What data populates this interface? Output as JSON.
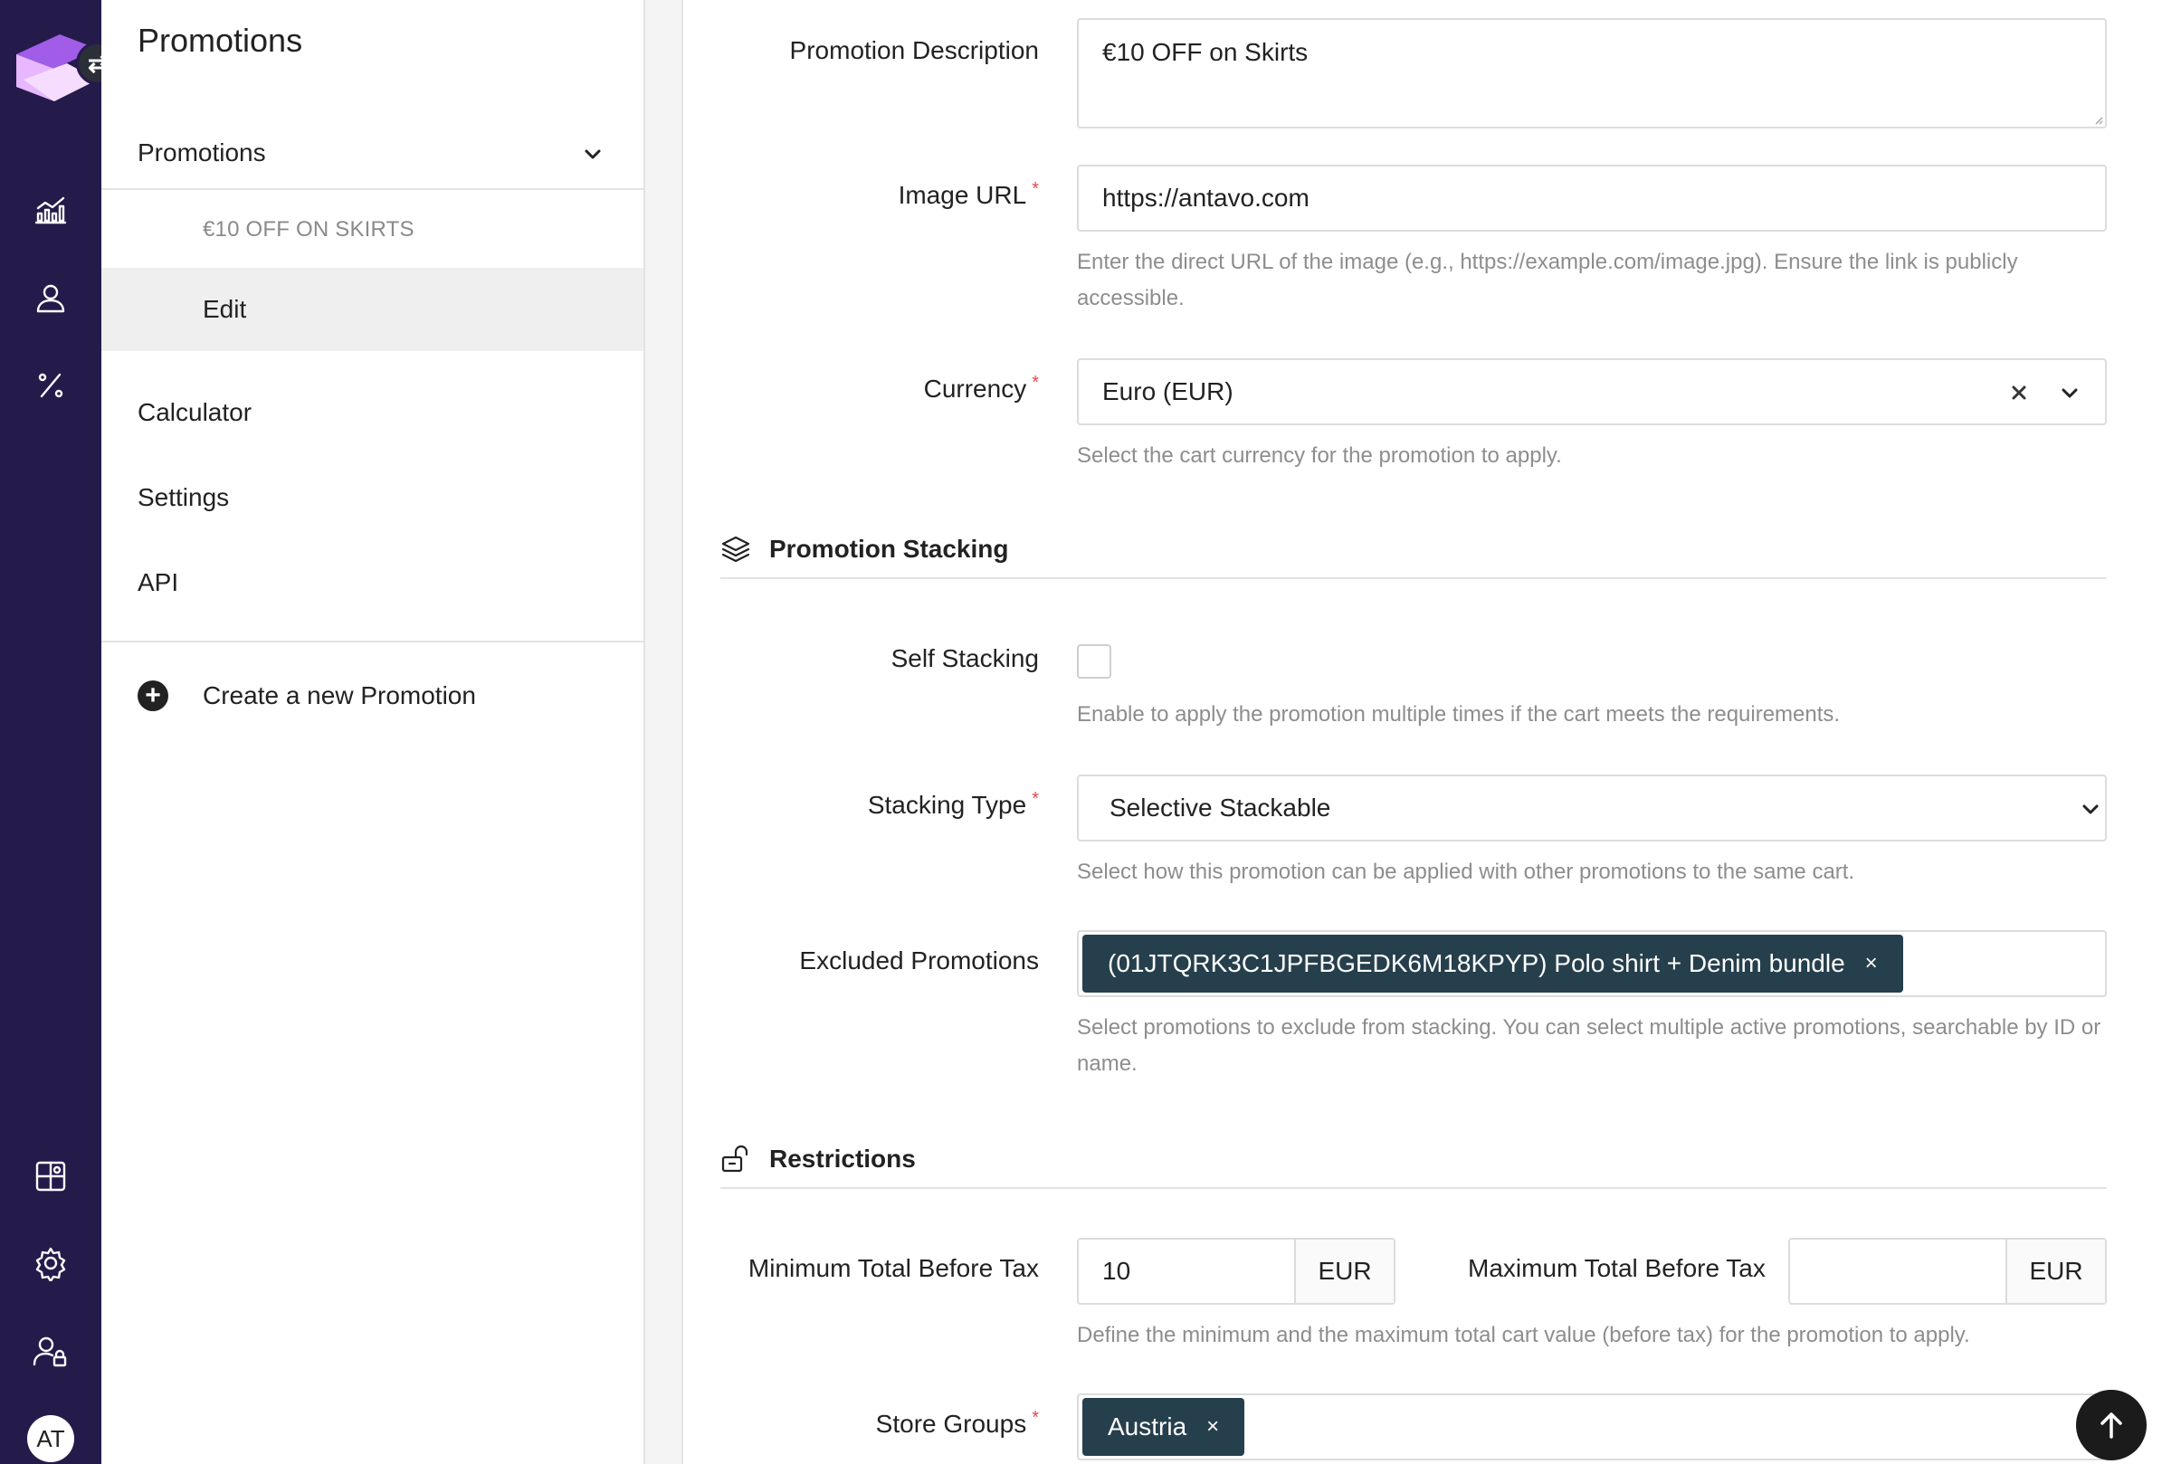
{
  "rail": {
    "avatar_initials": "AT",
    "icons": [
      "analytics-icon",
      "user-icon",
      "percent-icon",
      "integrations-icon",
      "settings-icon",
      "user-lock-icon"
    ]
  },
  "sidebar": {
    "title": "Promotions",
    "group_label": "Promotions",
    "sub_item_promotion": "€10 OFF ON SKIRTS",
    "sub_item_edit": "Edit",
    "items": [
      {
        "label": "Calculator"
      },
      {
        "label": "Settings"
      },
      {
        "label": "API"
      }
    ],
    "create_label": "Create a new Promotion"
  },
  "form": {
    "promotion_description": {
      "label": "Promotion Description",
      "value": "€10 OFF on Skirts"
    },
    "image_url": {
      "label": "Image URL",
      "required": "*",
      "value": "https://antavo.com",
      "help": "Enter the direct URL of the image (e.g., https://example.com/image.jpg). Ensure the link is publicly accessible."
    },
    "currency": {
      "label": "Currency",
      "required": "*",
      "value": "Euro (EUR)",
      "help": "Select the cart currency for the promotion to apply."
    },
    "stacking_section": {
      "title": "Promotion Stacking"
    },
    "self_stacking": {
      "label": "Self Stacking",
      "checked": false,
      "help": "Enable to apply the promotion multiple times if the cart meets the requirements."
    },
    "stacking_type": {
      "label": "Stacking Type",
      "required": "*",
      "value": "Selective Stackable",
      "help": "Select how this promotion can be applied with other promotions to the same cart."
    },
    "excluded_promotions": {
      "label": "Excluded Promotions",
      "tags": [
        "(01JTQRK3C1JPFBGEDK6M18KPYP) Polo shirt + Denim bundle"
      ],
      "help": "Select promotions to exclude from stacking. You can select multiple active promotions, searchable by ID or name."
    },
    "restrictions_section": {
      "title": "Restrictions"
    },
    "min_total": {
      "label": "Minimum Total Before Tax",
      "value": "10",
      "unit": "EUR"
    },
    "max_total": {
      "label": "Maximum Total Before Tax",
      "value": "",
      "unit": "EUR"
    },
    "total_help": "Define the minimum and the maximum total cart value (before tax) for the promotion to apply.",
    "store_groups": {
      "label": "Store Groups",
      "required": "*",
      "tags": [
        "Austria"
      ]
    },
    "tag_remove": "×"
  }
}
